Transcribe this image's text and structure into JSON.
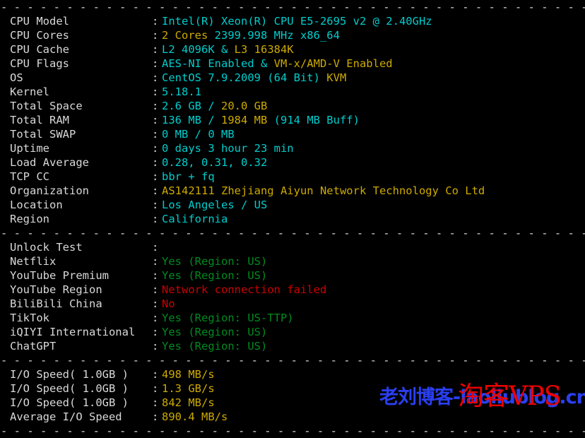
{
  "terminal": {
    "separator": "- - - - - - - - - - - - - - - - - - - - - - - - - - - - - - - - - - - - - - - - - - - - - - - - - - - - - - - - - - - - - - - - - -",
    "colon": ":",
    "background_color": "#000000",
    "label_color": "#d9d9d9",
    "accent_colors": {
      "cyan": "#00cdcd",
      "yellow": "#cdaa00",
      "green": "#008b1f",
      "red": "#cd0000",
      "white": "#d9d9d9"
    }
  },
  "sections": [
    {
      "id": "system-info",
      "rows": [
        {
          "label": "CPU Model",
          "parts": [
            {
              "text": "Intel(R) Xeon(R) CPU E5-2695 v2 @ 2.40GHz",
              "color": "cyan"
            }
          ]
        },
        {
          "label": "CPU Cores",
          "parts": [
            {
              "text": "2 Cores ",
              "color": "yellow"
            },
            {
              "text": "2399.998 MHz x86_64",
              "color": "cyan"
            }
          ]
        },
        {
          "label": "CPU Cache",
          "parts": [
            {
              "text": "L2 4096K & ",
              "color": "cyan"
            },
            {
              "text": "L3 16384K",
              "color": "yellow"
            }
          ]
        },
        {
          "label": "CPU Flags",
          "parts": [
            {
              "text": "AES-NI Enabled & ",
              "color": "cyan"
            },
            {
              "text": "VM-x/AMD-V Enabled",
              "color": "yellow"
            }
          ]
        },
        {
          "label": "OS",
          "parts": [
            {
              "text": "CentOS 7.9.2009 (64 Bit) ",
              "color": "cyan"
            },
            {
              "text": "KVM",
              "color": "yellow"
            }
          ]
        },
        {
          "label": "Kernel",
          "parts": [
            {
              "text": "5.18.1",
              "color": "cyan"
            }
          ]
        },
        {
          "label": "Total Space",
          "parts": [
            {
              "text": "2.6 GB / ",
              "color": "cyan"
            },
            {
              "text": "20.0 GB",
              "color": "yellow"
            }
          ]
        },
        {
          "label": "Total RAM",
          "parts": [
            {
              "text": "136 MB / ",
              "color": "cyan"
            },
            {
              "text": "1984 MB ",
              "color": "yellow"
            },
            {
              "text": "(914 MB Buff)",
              "color": "cyan"
            }
          ]
        },
        {
          "label": "Total SWAP",
          "parts": [
            {
              "text": "0 MB / 0 MB",
              "color": "cyan"
            }
          ]
        },
        {
          "label": "Uptime",
          "parts": [
            {
              "text": "0 days 3 hour 23 min",
              "color": "cyan"
            }
          ]
        },
        {
          "label": "Load Average",
          "parts": [
            {
              "text": "0.28, 0.31, 0.32",
              "color": "cyan"
            }
          ]
        },
        {
          "label": "TCP CC",
          "parts": [
            {
              "text": "bbr + fq",
              "color": "cyan"
            }
          ]
        },
        {
          "label": "Organization",
          "parts": [
            {
              "text": "AS142111 Zhejiang Aiyun Network Technology Co Ltd",
              "color": "yellow"
            }
          ]
        },
        {
          "label": "Location",
          "parts": [
            {
              "text": "Los Angeles / US",
              "color": "cyan"
            }
          ]
        },
        {
          "label": "Region",
          "parts": [
            {
              "text": "California",
              "color": "cyan"
            }
          ]
        }
      ]
    },
    {
      "id": "unlock-test",
      "rows": [
        {
          "label": "Unlock Test",
          "parts": [
            {
              "text": "",
              "color": "white"
            }
          ]
        },
        {
          "label": "Netflix",
          "parts": [
            {
              "text": "Yes (Region: US)",
              "color": "green"
            }
          ]
        },
        {
          "label": "YouTube Premium",
          "parts": [
            {
              "text": "Yes (Region: US)",
              "color": "green"
            }
          ]
        },
        {
          "label": "YouTube Region",
          "parts": [
            {
              "text": "Network connection failed",
              "color": "red"
            }
          ]
        },
        {
          "label": "BiliBili China",
          "parts": [
            {
              "text": "No",
              "color": "red"
            }
          ]
        },
        {
          "label": "TikTok",
          "parts": [
            {
              "text": "Yes (Region: US-TTP)",
              "color": "green"
            }
          ]
        },
        {
          "label": "iQIYI International",
          "parts": [
            {
              "text": "Yes (Region: US)",
              "color": "green"
            }
          ]
        },
        {
          "label": "ChatGPT",
          "parts": [
            {
              "text": "Yes (Region: US)",
              "color": "green"
            }
          ]
        }
      ]
    },
    {
      "id": "io-speed",
      "rows": [
        {
          "label": "I/O Speed( 1.0GB )",
          "parts": [
            {
              "text": "498 MB/s",
              "color": "yellow"
            }
          ]
        },
        {
          "label": "I/O Speed( 1.0GB )",
          "parts": [
            {
              "text": "1.3 GB/s",
              "color": "yellow"
            }
          ]
        },
        {
          "label": "I/O Speed( 1.0GB )",
          "parts": [
            {
              "text": "842 MB/s",
              "color": "yellow"
            }
          ]
        },
        {
          "label": "Average I/O Speed",
          "parts": [
            {
              "text": "890.4 MB/s",
              "color": "yellow"
            }
          ]
        }
      ]
    }
  ],
  "watermarks": {
    "blog": {
      "text": "老刘博客-laoliublog.cn",
      "color": "#2a3ff0"
    },
    "vps": {
      "text": "淘客VPS",
      "color": "#ee0000"
    }
  }
}
